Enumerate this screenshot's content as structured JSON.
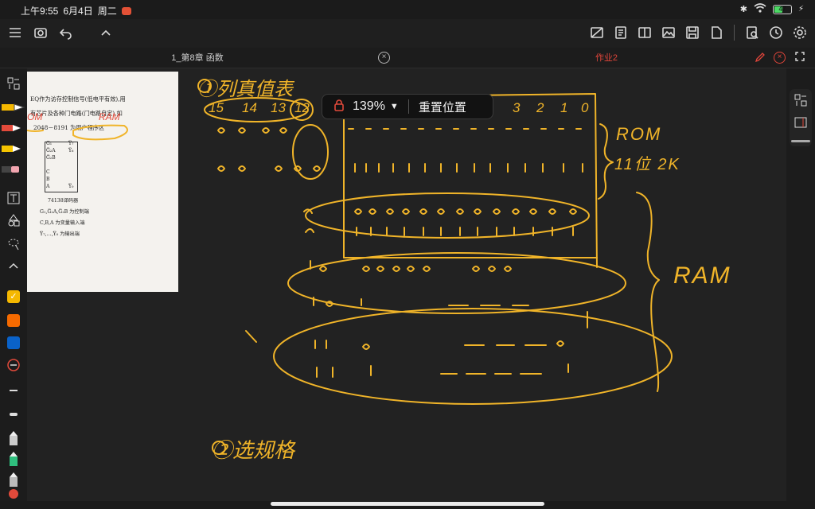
{
  "status": {
    "time": "上午9:55",
    "date": "6月4日",
    "weekday": "周二",
    "battery": "47",
    "rec_color": "#e35136"
  },
  "tabs": [
    {
      "label": "1_第8章 函数",
      "active": false
    },
    {
      "label": "作业2",
      "active": true,
      "color": "#e0453a"
    }
  ],
  "zoom": {
    "percent": "139%",
    "reset_label": "重置位置"
  },
  "document": {
    "lines": [
      "EQ作为访存控制信号(低电平有效),用",
      "有芯片及各种门电路(门电路自定),如",
      "2048－8191 为用户程序区"
    ],
    "chip_name": "74138译码器",
    "captions": [
      "G₁,G̅₂A,G̅₂B 为控制端",
      "C,B,A 为变量输入端",
      "Y̅₇,…,Y̅₀ 为输出端"
    ],
    "pins_left": [
      "G₁",
      "G̅₂A",
      "G̅₂B",
      "C",
      "B",
      "A"
    ],
    "pins_right": [
      "Y̅₇",
      "Y̅₆",
      "Y̅₀"
    ]
  },
  "handwriting": {
    "heading1": "①列真值表",
    "heading2": "②选规格",
    "rom_label": "ROM",
    "rom_detail": "11位 2K",
    "ram_label": "RAM",
    "ram_small": "RAM",
    "om_small": "OM",
    "bits_header": [
      "15",
      "14",
      "13",
      "12",
      "3",
      "2",
      "1",
      "0"
    ],
    "ink_color": "#f0b429"
  },
  "tools": {
    "swatches": [
      "#f5b800",
      "#f56a00",
      "#0a62c9"
    ]
  }
}
